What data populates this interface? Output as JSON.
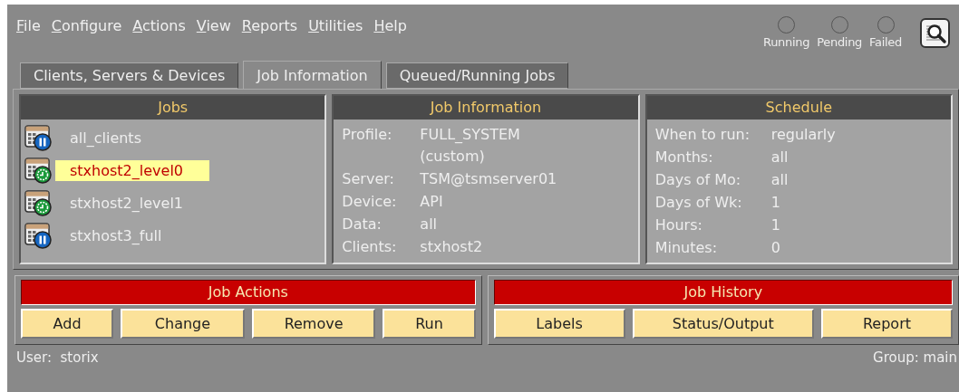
{
  "menu": [
    "File",
    "Configure",
    "Actions",
    "View",
    "Reports",
    "Utilities",
    "Help"
  ],
  "status_lights": [
    {
      "label": "Running",
      "on": false
    },
    {
      "label": "Pending",
      "on": false
    },
    {
      "label": "Failed",
      "on": false
    }
  ],
  "tabs": [
    {
      "label": "Clients, Servers & Devices",
      "selected": false
    },
    {
      "label": "Job Information",
      "selected": true
    },
    {
      "label": "Queued/Running Jobs",
      "selected": false
    }
  ],
  "jobs": {
    "title": "Jobs",
    "items": [
      {
        "label": "all_clients",
        "kind": "paused",
        "selected": false
      },
      {
        "label": "stxhost2_level0",
        "kind": "scheduled",
        "selected": true
      },
      {
        "label": "stxhost2_level1",
        "kind": "scheduled",
        "selected": false
      },
      {
        "label": "stxhost3_full",
        "kind": "paused",
        "selected": false
      }
    ]
  },
  "job_information": {
    "title": "Job Information",
    "fields": [
      {
        "label": "Profile:",
        "value": "FULL_SYSTEM",
        "extra": "(custom)"
      },
      {
        "label": "Server:",
        "value": "TSM@tsmserver01"
      },
      {
        "label": "Device:",
        "value": "API"
      },
      {
        "label": "Data:",
        "value": "all"
      },
      {
        "label": "Clients:",
        "value": "stxhost2"
      }
    ]
  },
  "schedule": {
    "title": "Schedule",
    "fields": [
      {
        "label": "When to run:",
        "value": "regularly"
      },
      {
        "label": "Months:",
        "value": "all"
      },
      {
        "label": "Days of Mo:",
        "value": "all"
      },
      {
        "label": "Days of Wk:",
        "value": "1"
      },
      {
        "label": "Hours:",
        "value": "1"
      },
      {
        "label": "Minutes:",
        "value": "0"
      }
    ]
  },
  "job_actions": {
    "title": "Job Actions",
    "buttons": [
      "Add",
      "Change",
      "Remove",
      "Run"
    ]
  },
  "job_history": {
    "title": "Job History",
    "buttons": [
      "Labels",
      "Status/Output",
      "Report"
    ]
  },
  "status_bar": {
    "user": "User:  storix",
    "group": "Group: main"
  }
}
